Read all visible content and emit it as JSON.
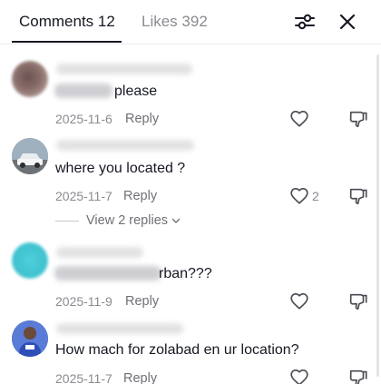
{
  "header": {
    "comments_tab": "Comments 12",
    "likes_tab": "Likes 392",
    "filter_icon": "sliders-icon",
    "close_icon": "close-icon"
  },
  "comments": [
    {
      "text": "please",
      "date": "2025-11-6",
      "reply": "Reply",
      "likes": ""
    },
    {
      "text": "where you located ?",
      "date": "2025-11-7",
      "reply": "Reply",
      "likes": "2",
      "view_replies": "View 2 replies"
    },
    {
      "text": "rban???",
      "date": "2025-11-9",
      "reply": "Reply",
      "likes": ""
    },
    {
      "text": "How mach for zolabad en ur location?",
      "date": "2025-11-7",
      "reply": "Reply",
      "likes": ""
    }
  ],
  "colors": {
    "text": "#161823",
    "muted": "#8a8b91",
    "teal_avatar": "#3fc2cf"
  }
}
